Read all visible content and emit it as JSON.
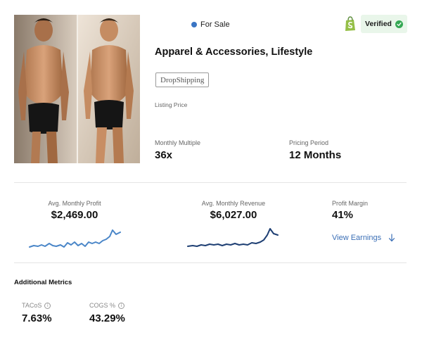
{
  "listing": {
    "status": "For Sale",
    "verified_label": "Verified",
    "title": "Apparel & Accessories, Lifestyle",
    "tag": "DropShipping",
    "listing_price_label": "Listing Price"
  },
  "stats": {
    "monthly_multiple_label": "Monthly Multiple",
    "monthly_multiple_value": "36x",
    "pricing_period_label": "Pricing Period",
    "pricing_period_value": "12 Months"
  },
  "metrics": {
    "profit_label": "Avg. Monthly Profit",
    "profit_value": "$2,469.00",
    "revenue_label": "Avg. Monthly Revenue",
    "revenue_value": "$6,027.00",
    "margin_label": "Profit Margin",
    "margin_value": "41%",
    "view_earnings": "View Earnings"
  },
  "additional": {
    "title": "Additional Metrics",
    "tacos_label": "TACoS",
    "tacos_value": "7.63%",
    "cogs_label": "COGS %",
    "cogs_value": "43.29%"
  },
  "icons": {
    "status_dot": "status-dot-icon",
    "platform": "shopify-icon",
    "verified": "check-circle-icon",
    "earnings_arrow": "arrow-down-icon",
    "info": "info-icon"
  },
  "colors": {
    "status_dot": "#3a75c4",
    "verified_bg": "#e9f6ea",
    "verified_check": "#34a853",
    "shopify": "#95bf47",
    "profit_line": "#4a86c8",
    "revenue_line": "#1e3f73",
    "link": "#3b6fb6"
  }
}
